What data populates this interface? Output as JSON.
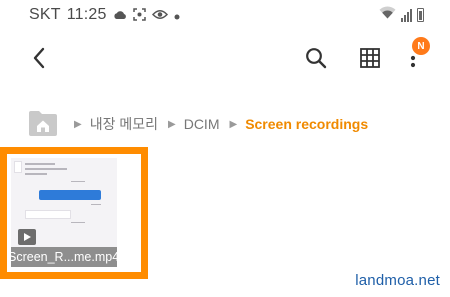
{
  "status_bar": {
    "carrier": "SKT",
    "time": "11:25",
    "icons": [
      "cloud-icon",
      "screenshot-icon",
      "eye-icon",
      "dot-icon"
    ],
    "right_icons": [
      "wifi-icon",
      "signal-icon",
      "battery-icon"
    ]
  },
  "toolbar": {
    "icons": [
      "back-arrow-icon",
      "search-icon",
      "grid-view-icon",
      "more-vert-icon"
    ],
    "badge": "N"
  },
  "breadcrumb": {
    "items": [
      {
        "label": "내장 메모리"
      },
      {
        "label": "DCIM"
      },
      {
        "label": "Screen recordings"
      }
    ]
  },
  "file": {
    "name": "Screen_R...me.mp4",
    "type_icon": "play-icon"
  },
  "watermark": "landmoa.net",
  "colors": {
    "accent": "#f08a00",
    "highlight_border": "#ff8c00",
    "badge": "#ff7a1a",
    "watermark": "#1f5fa8"
  }
}
